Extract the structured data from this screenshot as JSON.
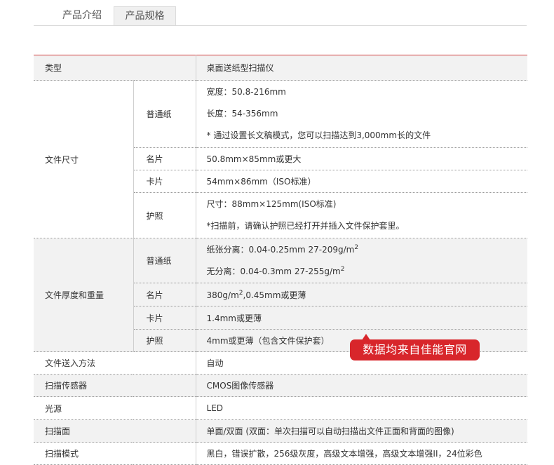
{
  "tabs": [
    "产品介绍",
    "产品规格"
  ],
  "rows": {
    "type": {
      "label": "类型",
      "value": "桌面送纸型扫描仪"
    },
    "doc_size": {
      "label": "文件尺寸",
      "plain": {
        "label": "普通纸",
        "lines": [
          "宽度：50.8-216mm",
          "长度：54-356mm",
          "* 通过设置长文稿模式，您可以扫描达到3,000mm长的文件"
        ]
      },
      "card": {
        "label": "名片",
        "value": "50.8mm×85mm或更大"
      },
      "id_card": {
        "label": "卡片",
        "value": "54mm×86mm（ISO标准）"
      },
      "passport": {
        "label": "护照",
        "lines": [
          "尺寸：88mm×125mm(ISO标准)",
          "*扫描前，请确认护照已经打开并插入文件保护套里。"
        ]
      }
    },
    "doc_weight": {
      "label": "文件厚度和重量",
      "plain": {
        "label": "普通纸",
        "line1": "纸张分离：0.04-0.25mm  27-209g/m",
        "line2": "无分离：0.04-0.3mm  27-255g/m",
        "sup": "2"
      },
      "card": {
        "label": "名片",
        "pre": "380g/m",
        "sup": "2",
        "post": ",0.45mm或更薄"
      },
      "id_card": {
        "label": "卡片",
        "value": "1.4mm或更薄"
      },
      "passport": {
        "label": "护照",
        "value": "4mm或更薄（包含文件保护套）"
      }
    },
    "feed": {
      "label": "文件送入方法",
      "value": "自动"
    },
    "sensor": {
      "label": "扫描传感器",
      "value": "CMOS图像传感器"
    },
    "light": {
      "label": "光源",
      "value": "LED"
    },
    "side": {
      "label": "扫描面",
      "value": "单面/双面 (双面：单次扫描可以自动扫描出文件正面和背面的图像)"
    },
    "mode": {
      "label": "扫描模式",
      "value": "黑白，错误扩散，256级灰度，高级文本增强，高级文本增强II，24位彩色"
    }
  },
  "watermark": "数据均来自佳能官网",
  "colors": {
    "accent": "#d23a3a",
    "watermark_bg": "#d8262b",
    "row_gray": "#f2f2f2"
  }
}
